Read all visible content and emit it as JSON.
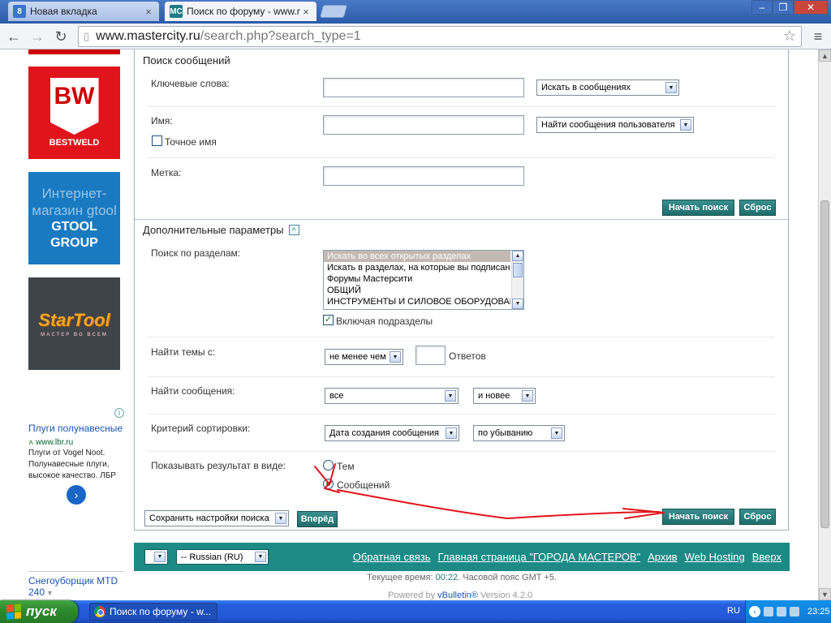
{
  "browser": {
    "tabs": [
      {
        "title": "Новая вкладка",
        "favicon": "8",
        "favicon_color": "#3b73d1",
        "close": "×"
      },
      {
        "title": "Поиск по форуму - www.ma",
        "favicon": "MC",
        "favicon_color": "#1f7a86",
        "close": "×"
      }
    ],
    "window_buttons": [
      "–",
      "❐",
      "✕"
    ],
    "nav": {
      "back": "←",
      "forward": "→",
      "reload": "↻",
      "menu": "≡",
      "star": "☆"
    },
    "url_host": "www.mastercity.ru",
    "url_path": "/search.php?search_type=1"
  },
  "sidebar_ads": {
    "bw_logo": "BW",
    "bw_name": "BESTWELD",
    "gtool_overlay": "Интернет-магазин gtool",
    "gtool_name": "GTOOL GROUP",
    "startool_logo": "StarTool",
    "startool_sub": "МАСТЕР ВО ВСЕМ",
    "google_ad": {
      "info": "i",
      "title": "Плуги полунавесные",
      "url": "www.lbr.ru",
      "text": "Плуги от Vogel Noot. Полунавесные плуги, высокое качество. ЛБР",
      "arrow": "›"
    },
    "bottom_link": "Снегоуборщик MTD 240",
    "bottom_caret": "▼"
  },
  "search_form": {
    "section1_title": "Поиск сообщений",
    "keywords_label": "Ключевые слова:",
    "keywords_value": "",
    "keywords_scope": "Искать в сообщениях",
    "name_label": "Имя:",
    "name_value": "",
    "name_scope": "Найти сообщения пользователя",
    "exact_name_label": "Точное имя",
    "exact_name_checked": false,
    "tag_label": "Метка:",
    "tag_value": "",
    "search_button": "Начать поиск",
    "reset_button": "Сброс",
    "section2_title": "Дополнительные параметры",
    "collapse_icon": "^",
    "forums_label": "Поиск по разделам:",
    "forums_options": [
      "Искать во всех открытых разделах",
      "Искать в разделах, на которые вы подписаны",
      "Форумы Мастерсити",
      "ОБЩИЙ",
      "ИНСТРУМЕНТЫ И СИЛОВОЕ ОБОРУДОВАНИЕ"
    ],
    "forums_selected_index": 0,
    "include_subforums_label": "Включая подразделы",
    "include_subforums_checked": true,
    "threads_label": "Найти темы с:",
    "threads_mode": "не менее чем",
    "threads_count": "",
    "replies_label": "Ответов",
    "posts_label": "Найти сообщения:",
    "posts_period": "все",
    "posts_direction": "и новее",
    "sort_label": "Критерий сортировки:",
    "sort_field": "Дата создания сообщения",
    "sort_order": "по убыванию",
    "show_as_label": "Показывать результат в виде:",
    "show_as_threads": "Тем",
    "show_as_posts": "Сообщений",
    "show_as_selected": "posts",
    "save_prefs": "Сохранить настройки поиска",
    "go_button": "Вперёд",
    "dropdown_arrow": "▼"
  },
  "footer": {
    "style_select": "",
    "language_select": "-- Russian (RU)",
    "links": [
      "Обратная связь",
      "Главная страница \"ГОРОДА МАСТЕРОВ\"",
      "Архив",
      "Web Hosting",
      "Вверх"
    ],
    "time_prefix": "Текущее время: ",
    "time_value": "00:22",
    "time_suffix": ". Часовой пояс GMT +5.",
    "powered_prefix": "Powered by ",
    "powered_link": "vBulletin®",
    "powered_suffix": " Version 4.2.0"
  },
  "annotation_color": "#e0141b",
  "taskbar": {
    "start_label": "пуск",
    "task_label": "Поиск по форуму - w...",
    "lang": "RU",
    "clock": "23:25"
  }
}
